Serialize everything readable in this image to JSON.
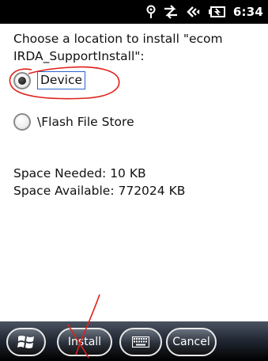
{
  "status_bar": {
    "time": "6:34",
    "icons": [
      "antenna-icon",
      "sync-arrows-icon",
      "speaker-icon",
      "battery-charging-icon"
    ]
  },
  "dialog": {
    "prompt": "Choose a location to install \"ecom IRDA_SupportInstall\":",
    "options": [
      {
        "label": "Device",
        "selected": true
      },
      {
        "label": "\\Flash File Store",
        "selected": false
      }
    ],
    "space_needed": "Space Needed:  10 KB",
    "space_available": "Space Available: 772024 KB"
  },
  "taskbar": {
    "start_icon": "windows-logo-icon",
    "install_label": "Install",
    "keyboard_icon": "keyboard-icon",
    "cancel_label": "Cancel"
  },
  "colors": {
    "annotation": "#e0201a",
    "focus_border": "#2a64c8"
  }
}
